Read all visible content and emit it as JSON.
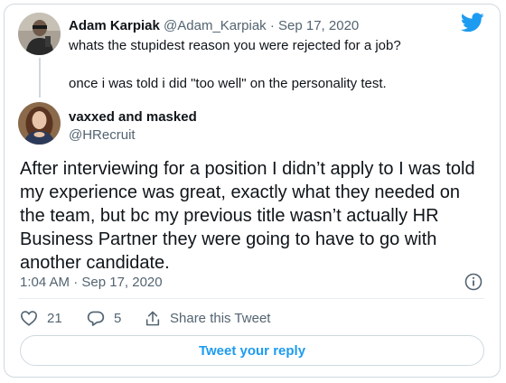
{
  "parent_tweet": {
    "name": "Adam Karpiak",
    "handle": "@Adam_Karpiak",
    "separator": "·",
    "date": "Sep 17, 2020",
    "line1": "whats the stupidest reason you were rejected for a job?",
    "line2": "once i was told i did \"too well\" on the personality test."
  },
  "main_tweet": {
    "name": "vaxxed and masked",
    "handle": "@HRecruit",
    "text": "After interviewing for a position I didn’t apply to I was told my experience was great, exactly what they needed on the team, but bc my previous title wasn’t actually HR Business Partner they were going to have to go with another candidate.",
    "timestamp": "1:04 AM · Sep 17, 2020"
  },
  "actions": {
    "like_count": "21",
    "reply_count": "5",
    "share_label": "Share this Tweet"
  },
  "reply_button_label": "Tweet your reply",
  "colors": {
    "accent": "#1d9bf0",
    "text": "#0f1419",
    "secondary": "#536471",
    "border": "#cfd9de"
  },
  "icons": [
    "twitter-bird-icon",
    "info-icon",
    "heart-icon",
    "reply-icon",
    "share-icon"
  ]
}
